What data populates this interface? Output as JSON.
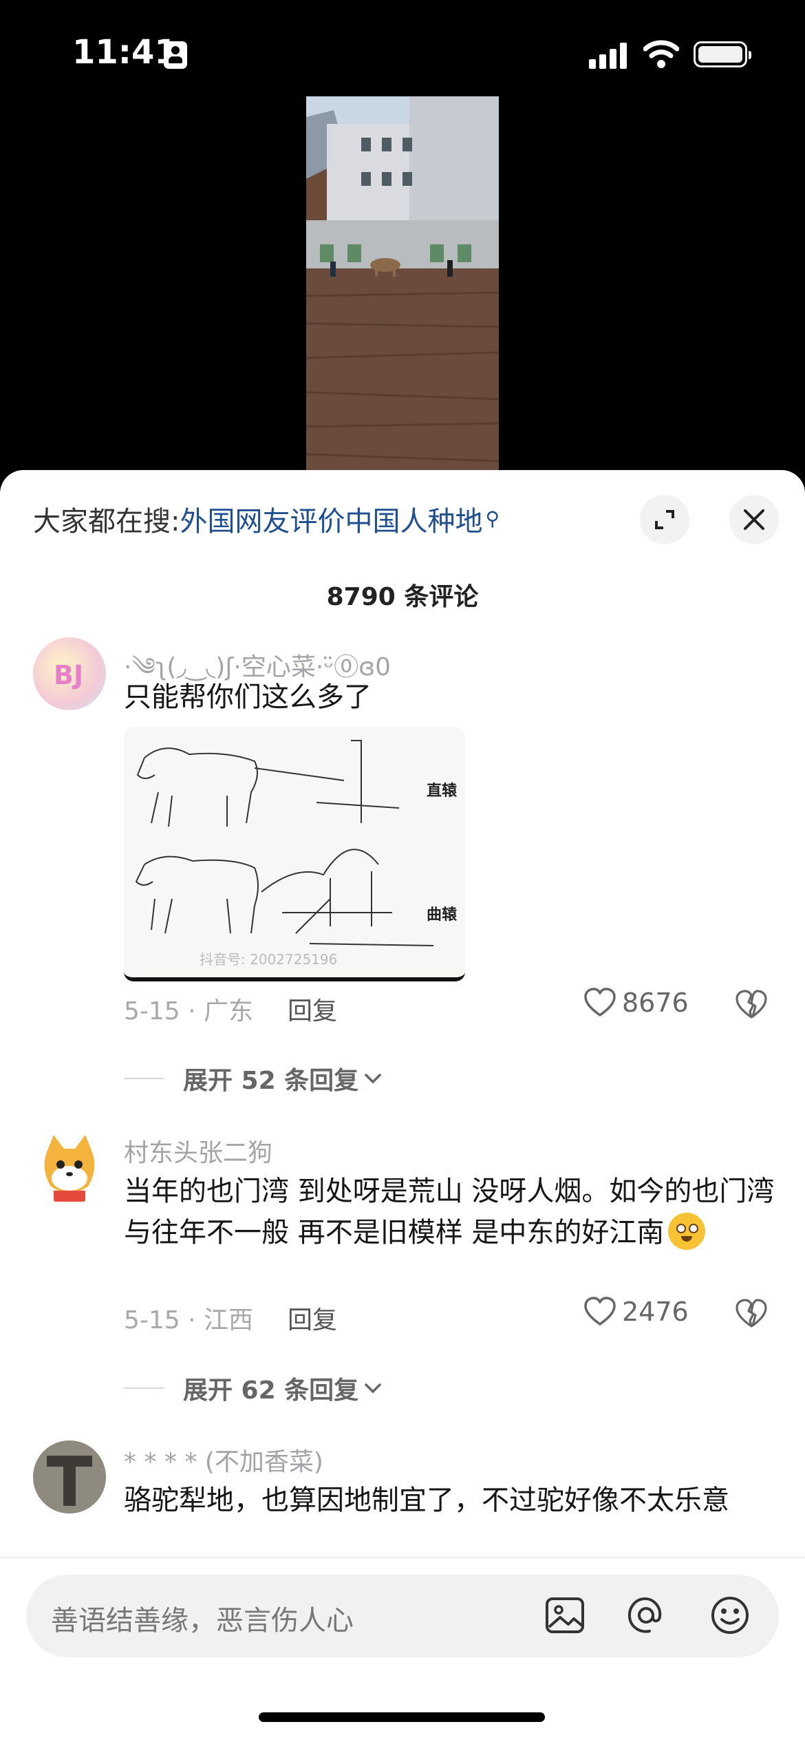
{
  "status_bar": {
    "time": "11:41"
  },
  "sheet": {
    "search_prefix": "大家都在搜:",
    "search_keyword": "外国网友评价中国人种地",
    "comment_count": "8790 条评论"
  },
  "comments": [
    {
      "username": "·༄ʅ(◞‿◟)ʃ·空心菜·ᵕ̈⓪ɞ0",
      "text": "只能帮你们这么多了",
      "image": {
        "label_top": "直辕",
        "label_bottom": "曲辕",
        "watermark": "抖音号: 2002725196"
      },
      "date_location": "5-15 · 广东",
      "reply_label": "回复",
      "likes": "8676",
      "expand_label": "展开 52 条回复"
    },
    {
      "username": "村东头张二狗",
      "text": "当年的也门湾 到处呀是荒山 没呀人烟。如今的也门湾 与往年不一般 再不是旧模样 是中东的好江南",
      "date_location": "5-15 · 江西",
      "reply_label": "回复",
      "likes": "2476",
      "expand_label": "展开 62 条回复"
    },
    {
      "username": "* * * * (不加香菜)",
      "text": "骆驼犁地，也算因地制宜了，不过驼好像不太乐意"
    }
  ],
  "input_bar": {
    "placeholder": "善语结善缘，恶言伤人心"
  },
  "colors": {
    "link": "#1f4f8f",
    "sheet_bg": "#ffffff",
    "muted": "#a3a3a8"
  },
  "icons": [
    "person-id-icon",
    "signal-icon",
    "wifi-icon",
    "battery-icon",
    "expand-icon",
    "close-icon",
    "heart-icon",
    "broken-heart-icon",
    "chevron-down-icon",
    "image-icon",
    "at-icon",
    "emoji-icon"
  ]
}
